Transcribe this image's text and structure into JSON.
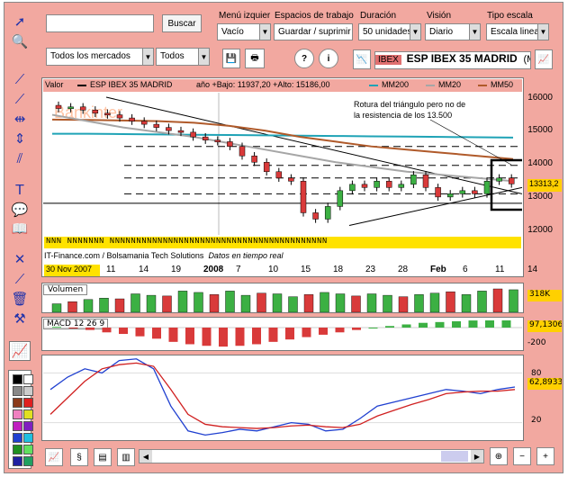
{
  "topbar": {
    "search_value": "",
    "search_button": "Buscar",
    "market_select": "Todos los mercados",
    "type_select": "Todos",
    "menu_label": "Menú izquier",
    "menu_value": "Vacío",
    "spaces_label": "Espacios de trabajo",
    "spaces_value": "Guardar / suprimir",
    "duration_label": "Duración",
    "duration_value": "50 unidades",
    "view_label": "Visión",
    "view_value": "Diario",
    "scale_label": "Tipo escala",
    "scale_value": "Escala lineal",
    "ticker_code": "IBEX",
    "ticker_name": "ESP IBEX 35 MADRID",
    "ticker_suffix": "(Me",
    "help_icon": "?",
    "info_icon": "i"
  },
  "price_panel": {
    "legend_value": "Valor",
    "legend_series": "ESP IBEX 35 MADRID",
    "legend_range": "año +Bajo: 11937,20 +Alto: 15186,00",
    "mm200": "MM200",
    "mm20": "MM20",
    "mm50": "MM50",
    "annotation_line1": "Rotura del triángulo pero no de",
    "annotation_line2": "la resistencia de los 13.500",
    "watermark": "Bankinter",
    "current_value": "13313,2",
    "y_ticks": [
      "16000",
      "15000",
      "14000",
      "13000",
      "12000"
    ],
    "footer_credit": "IT-Finance.com / Bolsamania Tech Solutions",
    "footer_realtime": "Datos en tiempo real",
    "date_badge": "30 Nov 2007",
    "n_markers": "NNN NNNNNNN NNNNNNNNNNNNNNNNNNNNNNNNNNNNNNNNNNNNNNNNN",
    "x_ticks": [
      "11",
      "14",
      "19",
      "2008",
      "7",
      "10",
      "15",
      "18",
      "23",
      "28",
      "Feb",
      "6",
      "11",
      "14"
    ]
  },
  "volume_panel": {
    "label": "Volumen",
    "current_value": "318K"
  },
  "macd_panel": {
    "label": "MACD 12 26 9",
    "current_value": "97,1306",
    "tick": "-200"
  },
  "stoch_panel": {
    "current_value": "62,8933",
    "ticks": [
      "80",
      "20"
    ]
  },
  "colors": {
    "frame": "#f2a8a0",
    "mm200": "#1fa3b6",
    "mm20": "#a6a6a6",
    "mm50": "#b05a2a",
    "up": "#3cb043",
    "down": "#d93a3a",
    "annotation_box": "#000000"
  },
  "chart_data": [
    {
      "type": "candlestick",
      "title": "ESP IBEX 35 MADRID",
      "ylim": [
        11700,
        16200
      ],
      "x": [
        "11",
        "14",
        "19",
        "2008",
        "7",
        "10",
        "15",
        "18",
        "23",
        "28",
        "Feb",
        "6",
        "11",
        "14"
      ],
      "series": [
        {
          "name": "MM200",
          "values": [
            14900,
            14900,
            14890,
            14880,
            14870,
            14860,
            14850,
            14840,
            14830,
            14820,
            14810,
            14800,
            14790,
            14780
          ]
        },
        {
          "name": "MM50",
          "values": [
            15350,
            15340,
            15320,
            15300,
            15250,
            15150,
            15000,
            14800,
            14650,
            14500,
            14400,
            14300,
            14200,
            14100
          ]
        }
      ]
    },
    {
      "type": "bar",
      "title": "Volumen",
      "values": [
        120,
        150,
        180,
        200,
        190,
        260,
        240,
        230,
        300,
        280,
        250,
        300,
        240,
        270,
        260,
        220,
        250,
        280,
        260,
        230,
        260,
        240,
        220,
        250,
        270,
        290,
        250,
        300,
        330,
        318
      ]
    },
    {
      "type": "bar",
      "title": "MACD 12 26 9",
      "values": [
        10,
        -10,
        -30,
        -60,
        -80,
        -110,
        -140,
        -180,
        -210,
        -230,
        -240,
        -230,
        -210,
        -180,
        -150,
        -120,
        -90,
        -60,
        -30,
        0,
        20,
        40,
        60,
        70,
        80,
        90,
        95,
        97
      ]
    },
    {
      "type": "line",
      "series": [
        {
          "name": "blue",
          "values": [
            60,
            75,
            85,
            80,
            95,
            97,
            85,
            40,
            10,
            5,
            8,
            12,
            10,
            15,
            20,
            18,
            10,
            12,
            25,
            40,
            45,
            50,
            55,
            60,
            58,
            55,
            60,
            63
          ]
        },
        {
          "name": "red",
          "values": [
            30,
            50,
            70,
            85,
            90,
            92,
            88,
            60,
            30,
            18,
            15,
            14,
            13,
            14,
            16,
            17,
            15,
            14,
            18,
            28,
            35,
            42,
            48,
            55,
            57,
            58,
            58,
            60
          ]
        }
      ]
    }
  ]
}
